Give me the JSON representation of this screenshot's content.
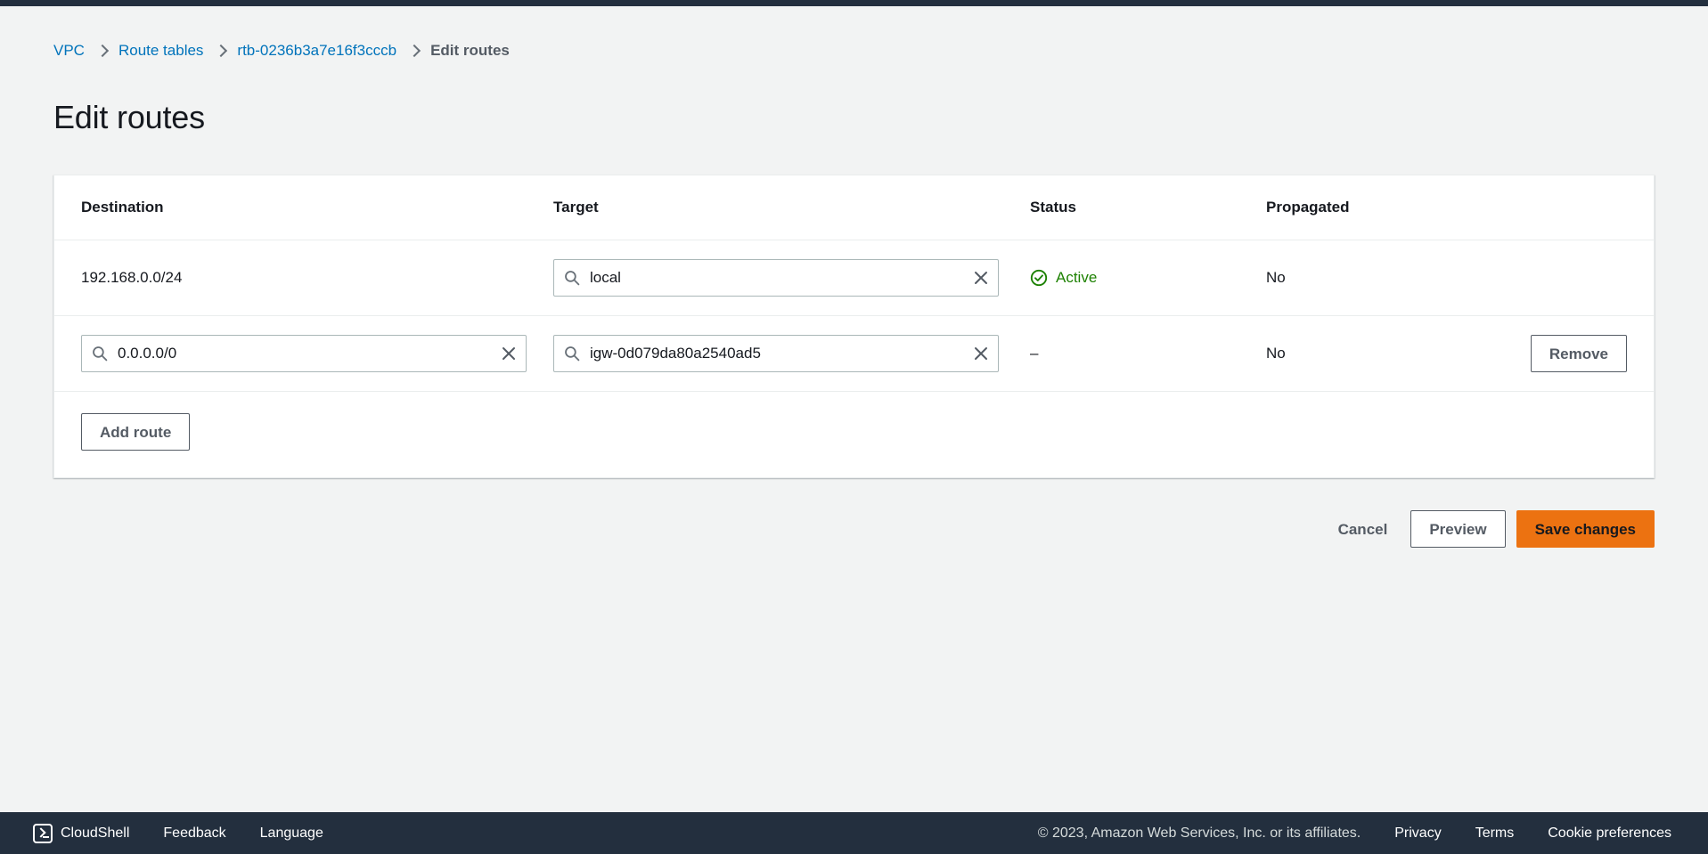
{
  "breadcrumb": {
    "items": [
      {
        "label": "VPC",
        "current": false
      },
      {
        "label": "Route tables",
        "current": false
      },
      {
        "label": "rtb-0236b3a7e16f3cccb",
        "current": false
      },
      {
        "label": "Edit routes",
        "current": true
      }
    ]
  },
  "page": {
    "title": "Edit routes"
  },
  "table": {
    "headers": {
      "destination": "Destination",
      "target": "Target",
      "status": "Status",
      "propagated": "Propagated"
    },
    "rows": [
      {
        "destination": "192.168.0.0/24",
        "destination_editable": false,
        "target": "local",
        "status": "Active",
        "status_icon": "status-positive-icon",
        "propagated": "No",
        "action": ""
      },
      {
        "destination": "0.0.0.0/0",
        "destination_editable": true,
        "target": "igw-0d079da80a2540ad5",
        "status": "–",
        "status_icon": "none",
        "propagated": "No",
        "action": "Remove"
      }
    ],
    "add_route_label": "Add route"
  },
  "actions": {
    "cancel": "Cancel",
    "preview": "Preview",
    "save": "Save changes"
  },
  "icons": {
    "search": "search-icon",
    "clear": "close-icon"
  },
  "footer": {
    "cloudshell": "CloudShell",
    "feedback": "Feedback",
    "language": "Language",
    "copyright": "© 2023, Amazon Web Services, Inc. or its affiliates.",
    "privacy": "Privacy",
    "terms": "Terms",
    "cookie_preferences": "Cookie preferences"
  },
  "colors": {
    "accent_link": "#0073bb",
    "primary_button": "#ec7211",
    "status_active": "#1d8102",
    "page_background": "#f2f3f3",
    "footer_background": "#232f3e"
  }
}
